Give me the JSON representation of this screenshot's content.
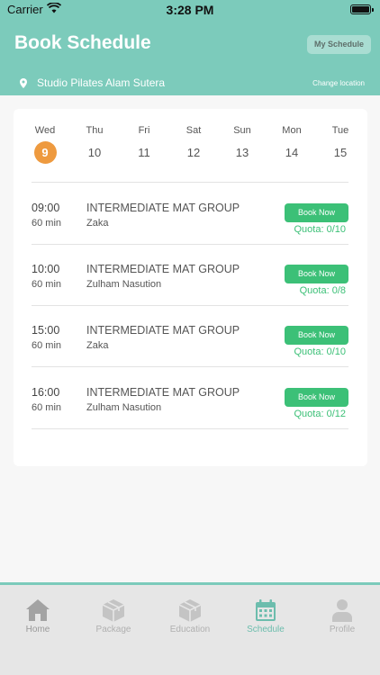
{
  "status_bar": {
    "carrier": "Carrier",
    "time": "3:28 PM"
  },
  "header": {
    "title": "Book Schedule",
    "my_schedule_label": "My Schedule",
    "location": "Studio Pilates Alam Sutera",
    "change_location_label": "Change location"
  },
  "days": [
    {
      "dow": "Wed",
      "num": "9",
      "selected": true
    },
    {
      "dow": "Thu",
      "num": "10"
    },
    {
      "dow": "Fri",
      "num": "11"
    },
    {
      "dow": "Sat",
      "num": "12"
    },
    {
      "dow": "Sun",
      "num": "13"
    },
    {
      "dow": "Mon",
      "num": "14"
    },
    {
      "dow": "Tue",
      "num": "15"
    }
  ],
  "sessions": [
    {
      "time": "09:00",
      "duration": "60 min",
      "class_name": "INTERMEDIATE MAT GROUP",
      "instructor": "Zaka",
      "button": "Book Now",
      "quota": "Quota: 0/10"
    },
    {
      "time": "10:00",
      "duration": "60 min",
      "class_name": "INTERMEDIATE MAT GROUP",
      "instructor": "Zulham Nasution",
      "button": "Book Now",
      "quota": "Quota: 0/8"
    },
    {
      "time": "15:00",
      "duration": "60 min",
      "class_name": "INTERMEDIATE MAT GROUP",
      "instructor": "Zaka",
      "button": "Book Now",
      "quota": "Quota: 0/10"
    },
    {
      "time": "16:00",
      "duration": "60 min",
      "class_name": "INTERMEDIATE MAT GROUP",
      "instructor": "Zulham Nasution",
      "button": "Book Now",
      "quota": "Quota: 0/12"
    }
  ],
  "tabs": [
    {
      "label": "Home",
      "icon": "home-icon"
    },
    {
      "label": "Package",
      "icon": "package-icon"
    },
    {
      "label": "Education",
      "icon": "education-icon"
    },
    {
      "label": "Schedule",
      "icon": "calendar-icon",
      "active": true
    },
    {
      "label": "Profile",
      "icon": "profile-icon"
    }
  ],
  "colors": {
    "brand": "#7ccbbb",
    "selected_day": "#ee9a3f",
    "book_button": "#3cc077",
    "active_tab": "#6cbdad"
  }
}
